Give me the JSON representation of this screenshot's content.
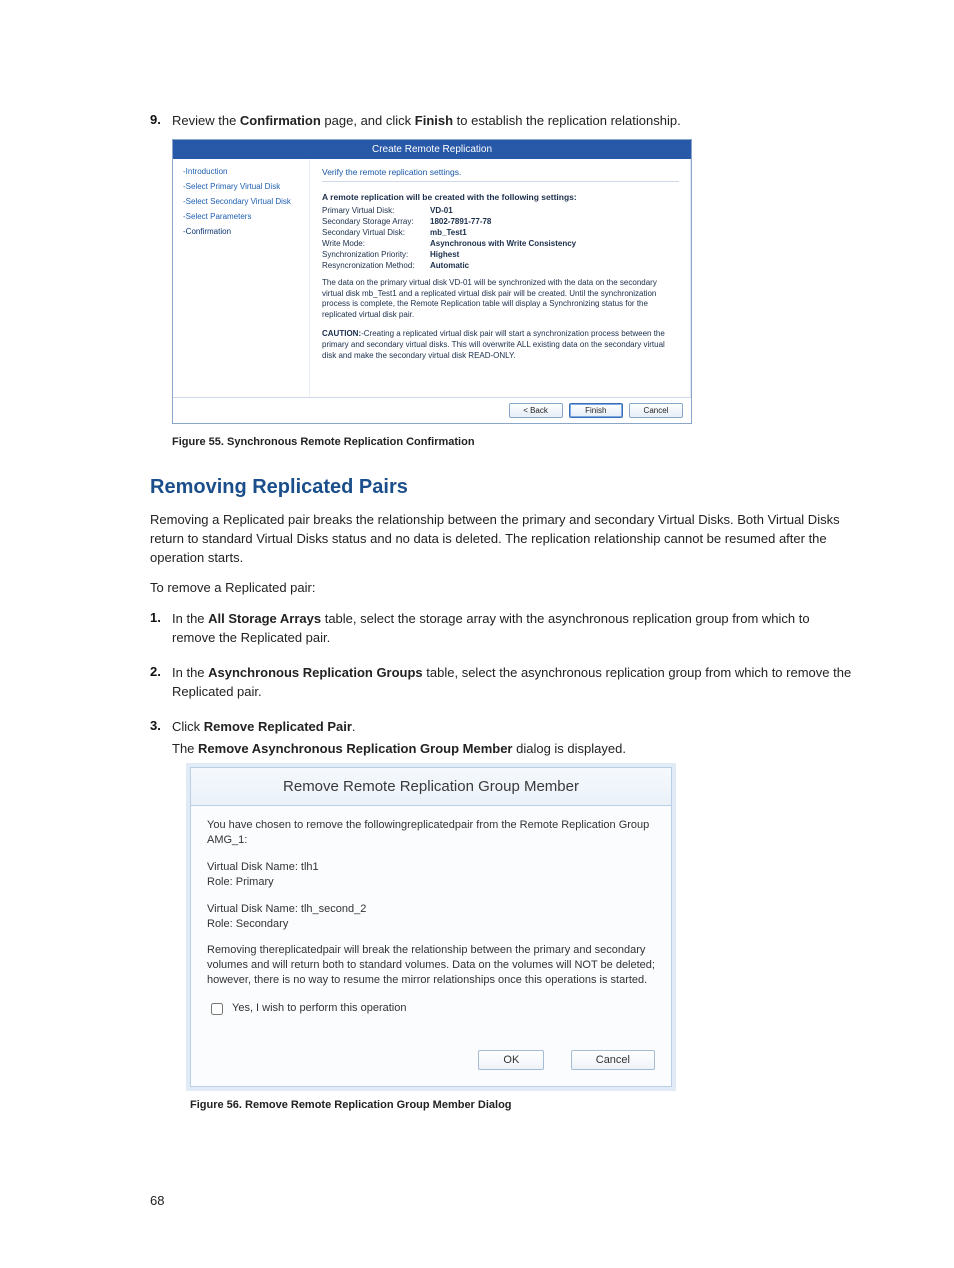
{
  "step9": {
    "num": "9.",
    "text_a": "Review the ",
    "text_b": "Confirmation",
    "text_c": " page, and click ",
    "text_d": "Finish",
    "text_e": " to establish the replication relationship."
  },
  "wizard": {
    "title": "Create Remote Replication",
    "nav": {
      "intro": "-Introduction",
      "selPrimary": "-Select Primary Virtual Disk",
      "selSecondary": "-Select Secondary Virtual Disk",
      "selParams": "-Select Parameters",
      "confirm": "-Confirmation"
    },
    "verify": "Verify the remote replication settings.",
    "heading": "A remote replication will be created with the following settings:",
    "rows": {
      "pvd_k": "Primary Virtual Disk:",
      "pvd_v": "VD-01",
      "ssa_k": "Secondary Storage Array:",
      "ssa_v": "1802-7891-77-78",
      "svd_k": "Secondary Virtual Disk:",
      "svd_v": "mb_Test1",
      "wm_k": "Write Mode:",
      "wm_v": "Asynchronous with Write Consistency",
      "sp_k": "Synchronization Priority:",
      "sp_v": "Highest",
      "rm_k": "Resyncronization Method:",
      "rm_v": "Automatic"
    },
    "para1": "The data on the primary virtual disk VD-01 will be synchronized with the data on the secondary virtual disk mb_Test1 and a replicated virtual disk pair will be created. Until the synchronization process is complete, the Remote Replication table will display a Synchronizing status for the replicated virtual disk pair.",
    "caution_label": "CAUTION:",
    "caution_text": "-Creating a replicated virtual disk pair will start a synchronization process between the primary and secondary virtual disks. This will overwrite ALL existing data on the secondary virtual disk and make the secondary virtual disk READ-ONLY.",
    "buttons": {
      "back": "< Back",
      "finish": "Finish",
      "cancel": "Cancel"
    }
  },
  "fig55": "Figure 55. Synchronous Remote Replication Confirmation",
  "h2": "Removing Replicated Pairs",
  "p1": "Removing a Replicated pair breaks the relationship between the primary and secondary Virtual Disks. Both Virtual Disks return to standard Virtual Disks status and no data is deleted. The replication relationship cannot be resumed after the operation starts.",
  "p2": "To remove a Replicated pair:",
  "step1": {
    "num": "1.",
    "a": "In the ",
    "b": "All Storage Arrays",
    "c": " table, select the storage array with the asynchronous replication group from which to remove the Replicated pair."
  },
  "step2": {
    "num": "2.",
    "a": "In the ",
    "b": "Asynchronous Replication Groups",
    "c": " table, select the asynchronous replication group from which to remove the Replicated pair."
  },
  "step3": {
    "num": "3.",
    "a": "Click ",
    "b": "Remove Replicated Pair",
    "c": ".",
    "d": "The ",
    "e": "Remove Asynchronous Replication Group Member",
    "f": " dialog is displayed."
  },
  "removeDialog": {
    "title": "Remove Remote Replication Group Member",
    "intro": "You have chosen to remove the followingreplicatedpair from the  Remote Replication   Group AMG_1:",
    "vd1a": "Virtual Disk Name: tlh1",
    "vd1b": "Role: Primary",
    "vd2a": "Virtual Disk Name: tlh_second_2",
    "vd2b": "Role: Secondary",
    "warn": "Removing thereplicatedpair will break the relationship between the primary and secondary volumes and will return both to standard volumes. Data on the volumes will NOT be deleted; however, there is no way to resume the mirror relationships once this operations is started.",
    "checkbox": "Yes, I wish to perform this operation",
    "ok": "OK",
    "cancel": "Cancel"
  },
  "fig56": "Figure 56. Remove Remote Replication Group Member Dialog",
  "pageNum": "68"
}
